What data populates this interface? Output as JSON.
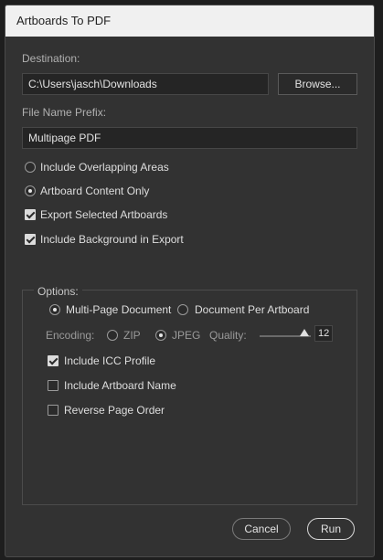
{
  "window": {
    "title": "Artboards To PDF"
  },
  "destination": {
    "label": "Destination:",
    "value": "C:\\Users\\jasch\\Downloads",
    "browse_label": "Browse..."
  },
  "prefix": {
    "label": "File Name Prefix:",
    "value": "Multipage PDF"
  },
  "options_main": [
    {
      "type": "radio",
      "label": "Include Overlapping Areas",
      "checked": false
    },
    {
      "type": "radio",
      "label": "Artboard Content Only",
      "checked": true
    },
    {
      "type": "checkbox",
      "label": "Export Selected Artboards",
      "checked": true
    },
    {
      "type": "checkbox",
      "label": "Include Background in Export",
      "checked": true
    }
  ],
  "options_group": {
    "title": "Options:",
    "mode": [
      {
        "label": "Multi-Page Document",
        "checked": true
      },
      {
        "label": "Document Per Artboard",
        "checked": false
      }
    ],
    "encoding": {
      "label": "Encoding:",
      "choices": [
        {
          "label": "ZIP",
          "checked": false
        },
        {
          "label": "JPEG",
          "checked": true
        }
      ],
      "quality_label": "Quality:",
      "quality_value": "12"
    },
    "checks": [
      {
        "label": "Include ICC Profile",
        "checked": true
      },
      {
        "label": "Include Artboard Name",
        "checked": false
      },
      {
        "label": "Reverse Page Order",
        "checked": false
      }
    ]
  },
  "footer": {
    "cancel_label": "Cancel",
    "run_label": "Run"
  }
}
